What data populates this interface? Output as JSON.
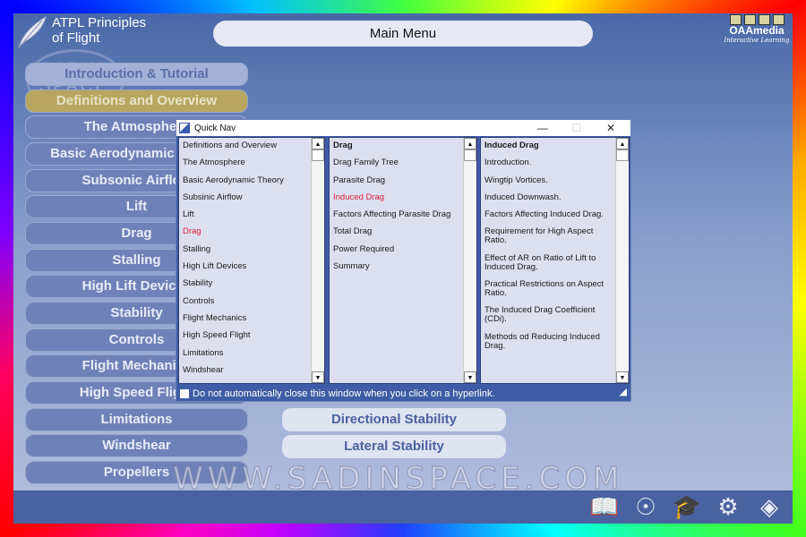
{
  "app": {
    "title_line1": "ATPL Principles",
    "title_line2": "of Flight",
    "main_menu": "Main Menu",
    "brand": "OAAmedia",
    "brand_sub": "Interactive Learning",
    "watermark_logo": "SADIN SPACE",
    "watermark_url": "WWW.SADINSPACE.COM"
  },
  "menu": [
    "Introduction & Tutorial",
    "Definitions and Overview",
    "The Atmosphere",
    "Basic Aerodynamic Theory",
    "Subsonic Airflow",
    "Lift",
    "Drag",
    "Stalling",
    "High Lift Devices",
    "Stability",
    "Controls",
    "Flight Mechanics",
    "High Speed Flight",
    "Limitations",
    "Windshear",
    "Propellers"
  ],
  "submenu": [
    "Directional Stability",
    "Lateral Stability"
  ],
  "bottom_icons": [
    "book-icon",
    "compass-icon",
    "graduation-cap-icon",
    "settings-gears-icon",
    "exit-icon"
  ],
  "quicknav": {
    "title": "Quick Nav",
    "col1": [
      "Definitions and Overview",
      "The Atmosphere",
      "Basic Aerodynamic Theory",
      "Subsinic Airflow",
      "Lift",
      "Drag",
      "Stalling",
      "High Lift Devices",
      "Stability",
      "Controls",
      "Flight Mechanics",
      "High Speed Flight",
      "Limitations",
      "Windshear"
    ],
    "col1_selected": "Drag",
    "col2": [
      "Drag",
      "Drag Family Tree",
      "Parasite Drag",
      "Induced Drag",
      "Factors Affecting Parasite Drag",
      "Total Drag",
      "Power Required",
      "Summary"
    ],
    "col2_selected": "Induced Drag",
    "col3": [
      "Induced Drag",
      "Introduction.",
      "Wingtip Vortices.",
      "Induced Downwash.",
      "Factors Affecting Induced Drag.",
      "Requirement for High Aspect Ratio.",
      "Effect of AR on Ratio of Lift to Induced Drag.",
      "Practical Restrictions on Aspect Ratio.",
      "The Induced Drag Coefficient (CDi).",
      "Methods od Reducing Induced Drag."
    ],
    "footer": "Do not automatically close this window when you click on a hyperlink.",
    "checkbox_checked": false
  }
}
